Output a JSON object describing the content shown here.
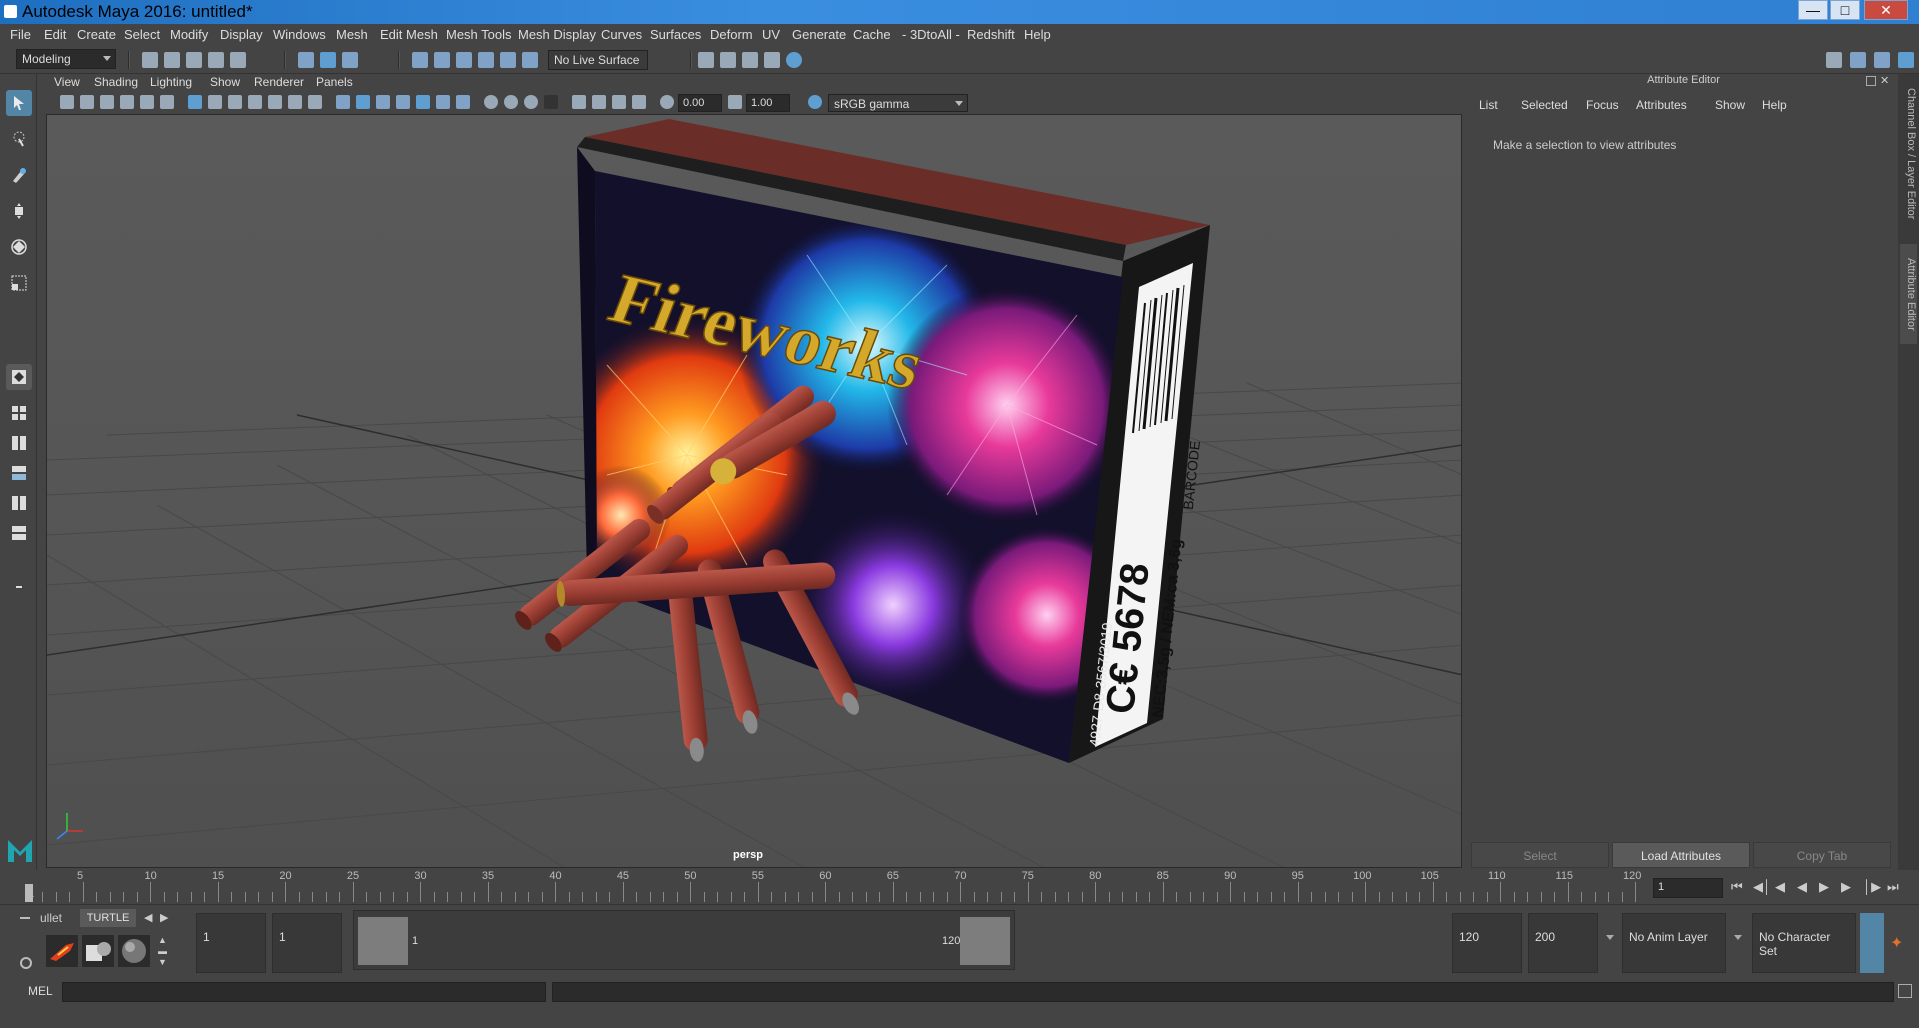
{
  "window": {
    "title": "Autodesk Maya 2016: untitled*"
  },
  "menubar": [
    "File",
    "Edit",
    "Create",
    "Select",
    "Modify",
    "Display",
    "Windows",
    "Mesh",
    "Edit Mesh",
    "Mesh Tools",
    "Mesh Display",
    "Curves",
    "Surfaces",
    "Deform",
    "UV",
    "Generate",
    "Cache",
    "- 3DtoAll -",
    "Redshift",
    "Help"
  ],
  "status_line": {
    "mode": "Modeling",
    "live_surface": "No Live Surface"
  },
  "panel": {
    "menus": [
      "View",
      "Shading",
      "Lighting",
      "Show",
      "Renderer",
      "Panels"
    ],
    "exposure": "0.00",
    "gamma": "1.00",
    "colorspace": "sRGB gamma",
    "camera_label": "persp"
  },
  "scene": {
    "box_title": "Fireworks",
    "box_code": "C€ 5678",
    "box_ident": "4927-D8-3567/3019",
    "box_nem": "NEC:3,5g / NEM:ca 3,6g",
    "barcode_label": "BARCODE"
  },
  "attribute_editor": {
    "title": "Attribute Editor",
    "menus": [
      "List",
      "Selected",
      "Focus",
      "Attributes",
      "Show",
      "Help"
    ],
    "message": "Make a selection to view attributes",
    "buttons": {
      "select": "Select",
      "load": "Load Attributes",
      "copy": "Copy Tab"
    }
  },
  "side_tabs": [
    "Channel Box / Layer Editor",
    "Attribute Editor"
  ],
  "timeline": {
    "ticks": [
      "5",
      "10",
      "15",
      "20",
      "25",
      "30",
      "35",
      "40",
      "45",
      "50",
      "55",
      "60",
      "65",
      "70",
      "75",
      "80",
      "85",
      "90",
      "95",
      "100",
      "105",
      "110",
      "115",
      "120"
    ],
    "start_marker": "1",
    "current_frame": "1"
  },
  "shelf": {
    "tabs": [
      "ullet",
      "TURTLE"
    ]
  },
  "range": {
    "start": "1",
    "inner_start": "1",
    "slider_start": "1",
    "slider_end": "120",
    "end": "120",
    "anim_end": "200",
    "anim_layer": "No Anim Layer",
    "character_set": "No Character Set"
  },
  "mel": {
    "label": "MEL"
  }
}
